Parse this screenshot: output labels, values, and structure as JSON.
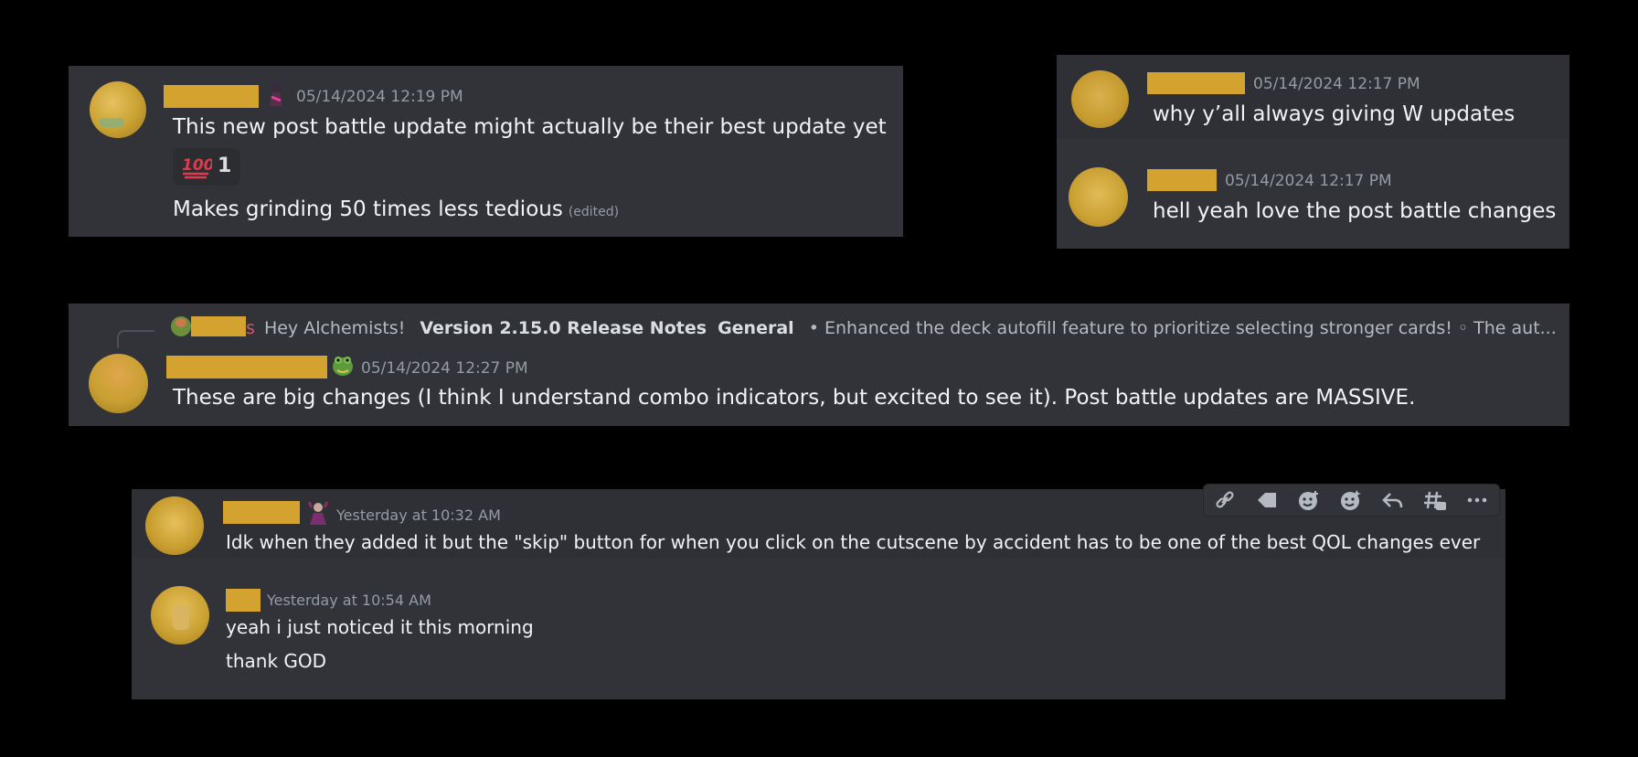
{
  "card1": {
    "timestamp": "05/14/2024 12:19 PM",
    "message1": "This new post battle update might actually be their best update yet",
    "reaction_count": "1",
    "message2": "Makes grinding 50 times less tedious",
    "edited_label": "(edited)"
  },
  "card2": {
    "msg1": {
      "timestamp": "05/14/2024 12:17 PM",
      "text": "why y’all always giving W updates"
    },
    "msg2": {
      "timestamp": "05/14/2024 12:17 PM",
      "text": "hell yeah love the post battle changes"
    }
  },
  "card3": {
    "reply": {
      "name_tail": "s",
      "text1": "Hey Alchemists!",
      "title": "Version 2.15.0 Release Notes",
      "channel": "General",
      "snippet": "• Enhanced the deck autofill feature to prioritize selecting stronger cards! ◦ The aut..."
    },
    "timestamp": "05/14/2024 12:27 PM",
    "message": "These are big changes (I think I understand combo indicators, but excited to see it). Post battle updates are MASSIVE."
  },
  "card4": {
    "msg1": {
      "timestamp": "Yesterday at 10:32 AM",
      "text": "Idk when they added it but the \"skip\" button for when you click on the cutscene by accident has to be one of the best QOL changes ever"
    },
    "msg2": {
      "timestamp": "Yesterday at 10:54 AM",
      "line1": "yeah i just noticed it this morning",
      "line2": "thank GOD"
    },
    "toolbar_icons": [
      "link-icon",
      "tag-icon",
      "add-reaction-icon",
      "super-reaction-icon",
      "reply-icon",
      "create-thread-icon",
      "more-icon"
    ]
  },
  "colors": {
    "background": "#000000",
    "card": "#313338",
    "redaction": "#d4a32f",
    "text": "#f2f3f5",
    "muted": "#949ba4"
  }
}
